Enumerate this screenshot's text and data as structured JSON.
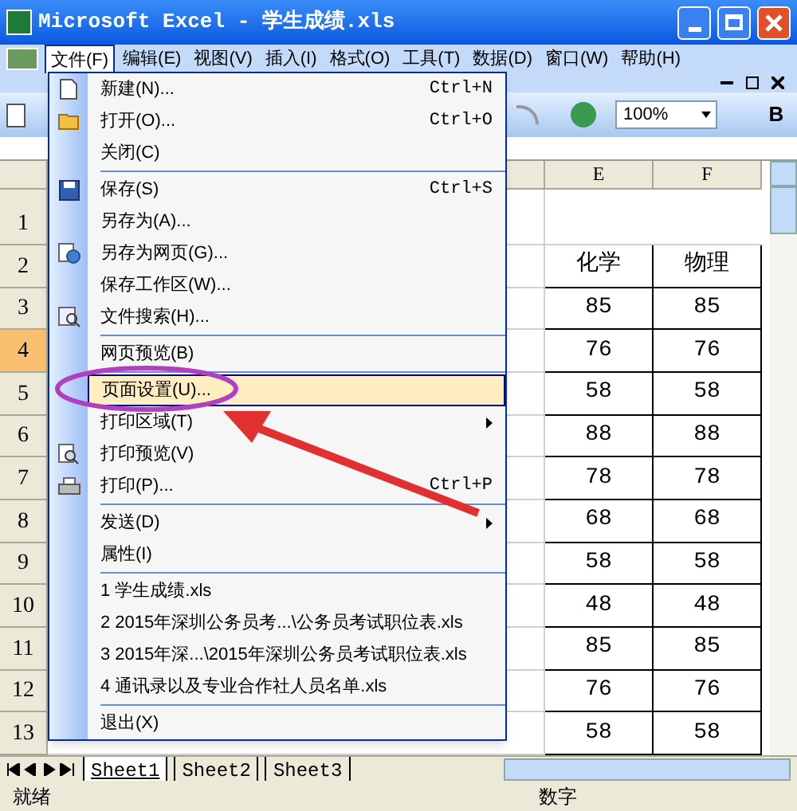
{
  "window": {
    "title": "Microsoft Excel - 学生成绩.xls"
  },
  "menubar": [
    {
      "label": "文件(F)",
      "selected": true
    },
    {
      "label": "编辑(E)",
      "selected": false
    },
    {
      "label": "视图(V)",
      "selected": false
    },
    {
      "label": "插入(I)",
      "selected": false
    },
    {
      "label": "格式(O)",
      "selected": false
    },
    {
      "label": "工具(T)",
      "selected": false
    },
    {
      "label": "数据(D)",
      "selected": false
    },
    {
      "label": "窗口(W)",
      "selected": false
    },
    {
      "label": "帮助(H)",
      "selected": false
    }
  ],
  "toolbar": {
    "zoom": "100%",
    "bold": "B"
  },
  "sheet": {
    "columns": [
      "E",
      "F"
    ],
    "rows": [
      {
        "header": "1",
        "selected": false,
        "tall": true
      },
      {
        "header": "2",
        "selected": false,
        "cells": [
          "化学",
          "物理"
        ]
      },
      {
        "header": "3",
        "selected": false,
        "cells": [
          "85",
          "85"
        ]
      },
      {
        "header": "4",
        "selected": true,
        "cells": [
          "76",
          "76"
        ]
      },
      {
        "header": "5",
        "selected": false,
        "cells": [
          "58",
          "58"
        ]
      },
      {
        "header": "6",
        "selected": false,
        "cells": [
          "88",
          "88"
        ]
      },
      {
        "header": "7",
        "selected": false,
        "cells": [
          "78",
          "78"
        ]
      },
      {
        "header": "8",
        "selected": false,
        "cells": [
          "68",
          "68"
        ]
      },
      {
        "header": "9",
        "selected": false,
        "cells": [
          "58",
          "58"
        ]
      },
      {
        "header": "10",
        "selected": false,
        "cells": [
          "48",
          "48"
        ]
      },
      {
        "header": "11",
        "selected": false,
        "cells": [
          "85",
          "85"
        ]
      },
      {
        "header": "12",
        "selected": false,
        "cells": [
          "76",
          "76"
        ]
      },
      {
        "header": "13",
        "selected": false,
        "cells": [
          "58",
          "58"
        ]
      }
    ]
  },
  "file_menu": [
    {
      "kind": "item",
      "label": "新建(N)...",
      "shortcut": "Ctrl+N",
      "selected": false
    },
    {
      "kind": "item",
      "label": "打开(O)...",
      "shortcut": "Ctrl+O",
      "selected": false
    },
    {
      "kind": "item",
      "label": "关闭(C)",
      "selected": false
    },
    {
      "kind": "separator"
    },
    {
      "kind": "item",
      "label": "保存(S)",
      "shortcut": "Ctrl+S",
      "selected": false
    },
    {
      "kind": "item",
      "label": "另存为(A)...",
      "selected": false
    },
    {
      "kind": "item",
      "label": "另存为网页(G)...",
      "selected": false
    },
    {
      "kind": "item",
      "label": "保存工作区(W)...",
      "selected": false
    },
    {
      "kind": "item",
      "label": "文件搜索(H)...",
      "selected": false
    },
    {
      "kind": "separator"
    },
    {
      "kind": "item",
      "label": "网页预览(B)",
      "selected": false
    },
    {
      "kind": "separator"
    },
    {
      "kind": "item",
      "label": "页面设置(U)...",
      "selected": true
    },
    {
      "kind": "item",
      "label": "打印区域(T)",
      "submenu": true,
      "selected": false
    },
    {
      "kind": "item",
      "label": "打印预览(V)",
      "selected": false
    },
    {
      "kind": "item",
      "label": "打印(P)...",
      "shortcut": "Ctrl+P",
      "selected": false
    },
    {
      "kind": "separator"
    },
    {
      "kind": "item",
      "label": "发送(D)",
      "submenu": true,
      "selected": false
    },
    {
      "kind": "item",
      "label": "属性(I)",
      "selected": false
    },
    {
      "kind": "separator"
    },
    {
      "kind": "item",
      "label": "1 学生成绩.xls",
      "selected": false
    },
    {
      "kind": "item",
      "label": "2 2015年深圳公务员考...\\公务员考试职位表.xls",
      "selected": false
    },
    {
      "kind": "item",
      "label": "3 2015年深...\\2015年深圳公务员考试职位表.xls",
      "selected": false
    },
    {
      "kind": "item",
      "label": "4 通讯录以及专业合作社人员名单.xls",
      "selected": false
    },
    {
      "kind": "separator"
    },
    {
      "kind": "item",
      "label": "退出(X)",
      "selected": false
    }
  ],
  "sheet_tabs": [
    {
      "label": "Sheet1",
      "selected": true
    },
    {
      "label": "Sheet2",
      "selected": false
    },
    {
      "label": "Sheet3",
      "selected": false
    }
  ],
  "status_bar": {
    "status": "就绪",
    "mode": "数字"
  }
}
